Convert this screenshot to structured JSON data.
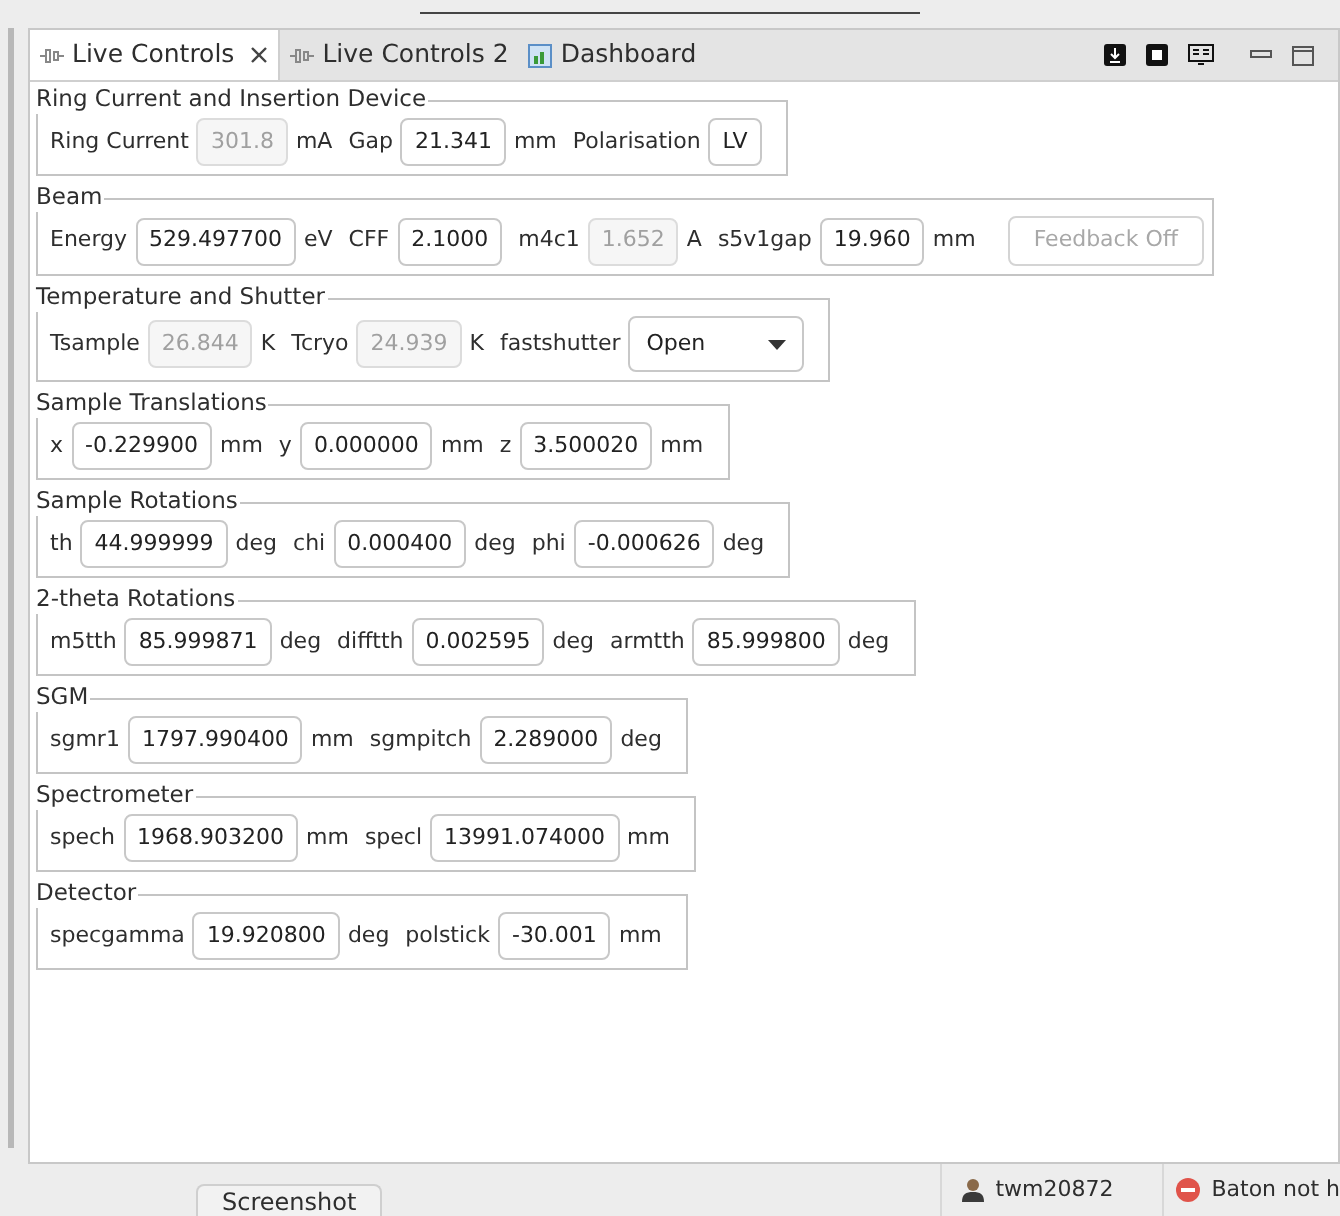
{
  "tabs": [
    {
      "label": "Live Controls",
      "selected": true,
      "closable": true,
      "kind": "plug"
    },
    {
      "label": "Live Controls 2",
      "selected": false,
      "closable": false,
      "kind": "plug"
    },
    {
      "label": "Dashboard",
      "selected": false,
      "closable": false,
      "kind": "chart"
    }
  ],
  "groups": [
    {
      "title": "Ring Current and Insertion Device",
      "controls": [
        {
          "kind": "field",
          "label": "Ring Current",
          "value": "301.8",
          "unit": "mA",
          "disabled": true
        },
        {
          "kind": "field",
          "label": "Gap",
          "value": "21.341",
          "unit": "mm",
          "disabled": false
        },
        {
          "kind": "field",
          "label": "Polarisation",
          "value": "LV",
          "disabled": false
        }
      ]
    },
    {
      "title": "Beam",
      "controls": [
        {
          "kind": "field",
          "label": "Energy",
          "value": "529.497700",
          "unit": "eV",
          "disabled": false
        },
        {
          "kind": "field",
          "label": "CFF",
          "value": "2.1000",
          "disabled": false
        },
        {
          "kind": "field",
          "label": "m4c1",
          "value": "1.652",
          "unit": "A",
          "disabled": true
        },
        {
          "kind": "field",
          "label": "s5v1gap",
          "value": "19.960",
          "unit": "mm",
          "disabled": false
        },
        {
          "kind": "button",
          "label": "Feedback Off",
          "disabled": true
        }
      ]
    },
    {
      "title": "Temperature and Shutter",
      "controls": [
        {
          "kind": "field",
          "label": "Tsample",
          "value": "26.844",
          "unit": "K",
          "disabled": true
        },
        {
          "kind": "field",
          "label": "Tcryo",
          "value": "24.939",
          "unit": "K",
          "disabled": true
        },
        {
          "kind": "dropdown",
          "label": "fastshutter",
          "value": "Open",
          "disabled": false
        }
      ]
    },
    {
      "title": "Sample Translations",
      "controls": [
        {
          "kind": "field",
          "label": "x",
          "value": "-0.229900",
          "unit": "mm",
          "disabled": false
        },
        {
          "kind": "field",
          "label": "y",
          "value": "0.000000",
          "unit": "mm",
          "disabled": false
        },
        {
          "kind": "field",
          "label": "z",
          "value": "3.500020",
          "unit": "mm",
          "disabled": false
        }
      ]
    },
    {
      "title": "Sample Rotations",
      "controls": [
        {
          "kind": "field",
          "label": "th",
          "value": "44.999999",
          "unit": "deg",
          "disabled": false
        },
        {
          "kind": "field",
          "label": "chi",
          "value": "0.000400",
          "unit": "deg",
          "disabled": false
        },
        {
          "kind": "field",
          "label": "phi",
          "value": "-0.000626",
          "unit": "deg",
          "disabled": false
        }
      ]
    },
    {
      "title": "2-theta Rotations",
      "controls": [
        {
          "kind": "field",
          "label": "m5tth",
          "value": "85.999871",
          "unit": "deg",
          "disabled": false
        },
        {
          "kind": "field",
          "label": "difftth",
          "value": "0.002595",
          "unit": "deg",
          "disabled": false
        },
        {
          "kind": "field",
          "label": "armtth",
          "value": "85.999800",
          "unit": "deg",
          "disabled": false
        }
      ]
    },
    {
      "title": "SGM",
      "controls": [
        {
          "kind": "field",
          "label": "sgmr1",
          "value": "1797.990400",
          "unit": "mm",
          "disabled": false
        },
        {
          "kind": "field",
          "label": "sgmpitch",
          "value": "2.289000",
          "unit": "deg",
          "disabled": false
        }
      ]
    },
    {
      "title": "Spectrometer",
      "controls": [
        {
          "kind": "field",
          "label": "spech",
          "value": "1968.903200",
          "unit": "mm",
          "disabled": false
        },
        {
          "kind": "field",
          "label": "specl",
          "value": "13991.074000",
          "unit": "mm",
          "disabled": false
        }
      ]
    },
    {
      "title": "Detector",
      "controls": [
        {
          "kind": "field",
          "label": "specgamma",
          "value": "19.920800",
          "unit": "deg",
          "disabled": false
        },
        {
          "kind": "field",
          "label": "polstick",
          "value": "-30.001",
          "unit": "mm",
          "disabled": false
        }
      ]
    }
  ],
  "bottom_button": "Screenshot",
  "status": {
    "user": "twm20872",
    "baton": "Baton not h"
  }
}
